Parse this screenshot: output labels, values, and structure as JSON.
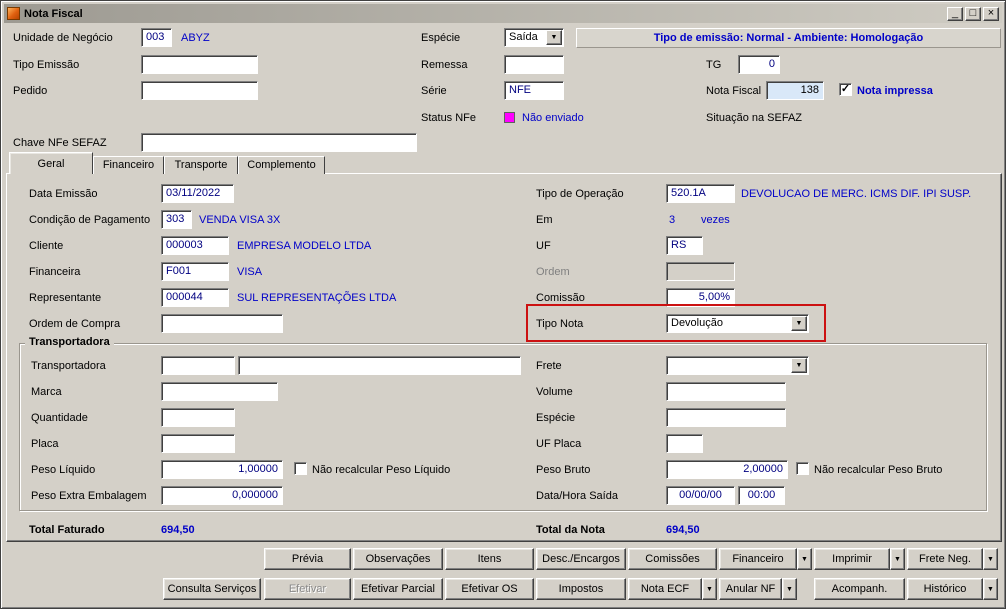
{
  "window": {
    "title": "Nota Fiscal"
  },
  "icons": {
    "dropdown_arrow": "▼",
    "checkmark": "✓",
    "minimize": "_",
    "maximize": "□",
    "close": "×"
  },
  "colors": {
    "window_bg": "#d4d0c8",
    "accent_blue": "#0000C8",
    "field_text_navy": "#000080",
    "status_magenta": "#FF00FF",
    "annotation_red": "#CC1111",
    "nota_fiscal_field_bg": "#d9e8f8"
  },
  "header": {
    "unidade_label": "Unidade de Negócio",
    "unidade_code": "003",
    "unidade_desc": "ABYZ",
    "tipo_emissao_label": "Tipo Emissão",
    "pedido_label": "Pedido",
    "especie_label": "Espécie",
    "especie_value": "Saída",
    "remessa_label": "Remessa",
    "serie_label": "Série",
    "serie_value": "NFE",
    "status_nfe_label": "Status NFe",
    "status_nfe_value": "Não enviado",
    "banner": "Tipo de emissão: Normal - Ambiente: Homologação",
    "tg_label": "TG",
    "tg_value": "0",
    "nota_fiscal_label": "Nota Fiscal",
    "nota_fiscal_value": "138",
    "nota_impressa_label": "Nota impressa",
    "situacao_sefaz_label": "Situação na SEFAZ",
    "chave_label": "Chave NFe SEFAZ"
  },
  "tabs": [
    {
      "label": "Geral"
    },
    {
      "label": "Financeiro"
    },
    {
      "label": "Transporte"
    },
    {
      "label": "Complemento"
    }
  ],
  "geral": {
    "data_emissao_label": "Data Emissão",
    "data_emissao_value": "03/11/2022",
    "cond_pag_label": "Condição de Pagamento",
    "cond_pag_code": "303",
    "cond_pag_desc": "VENDA VISA 3X",
    "cliente_label": "Cliente",
    "cliente_code": "000003",
    "cliente_desc": "EMPRESA MODELO LTDA",
    "financeira_label": "Financeira",
    "financeira_code": "F001",
    "financeira_desc": "VISA",
    "representante_label": "Representante",
    "representante_code": "000044",
    "representante_desc": "SUL REPRESENTAÇÕES LTDA",
    "ordem_compra_label": "Ordem de Compra",
    "tipo_operacao_label": "Tipo de Operação",
    "tipo_operacao_code": "520.1A",
    "tipo_operacao_desc": "DEVOLUCAO DE MERC. ICMS DIF. IPI SUSP.",
    "em_label": "Em",
    "em_value": "3",
    "em_suffix": "vezes",
    "uf_label": "UF",
    "uf_value": "RS",
    "ordem_label": "Ordem",
    "comissao_label": "Comissão",
    "comissao_value": "5,00%",
    "tipo_nota_label": "Tipo Nota",
    "tipo_nota_value": "Devolução"
  },
  "transportadora": {
    "group_label": "Transportadora",
    "transportadora_label": "Transportadora",
    "marca_label": "Marca",
    "quantidade_label": "Quantidade",
    "placa_label": "Placa",
    "peso_liquido_label": "Peso Líquido",
    "peso_liquido_value": "1,00000",
    "nao_recalc_liquido_label": "Não recalcular Peso Líquido",
    "peso_extra_label": "Peso Extra Embalagem",
    "peso_extra_value": "0,000000",
    "frete_label": "Frete",
    "volume_label": "Volume",
    "especie_label": "Espécie",
    "uf_placa_label": "UF Placa",
    "peso_bruto_label": "Peso Bruto",
    "peso_bruto_value": "2,00000",
    "nao_recalc_bruto_label": "Não recalcular Peso Bruto",
    "data_hora_label": "Data/Hora Saída",
    "data_saida_value": "00/00/00",
    "hora_saida_value": "00:00"
  },
  "totals": {
    "faturado_label": "Total Faturado",
    "faturado_value": "694,50",
    "nota_label": "Total da Nota",
    "nota_value": "694,50"
  },
  "buttons_row1": [
    {
      "label": "Prévia"
    },
    {
      "label": "Observações"
    },
    {
      "label": "Itens"
    },
    {
      "label": "Desc./Encargos"
    },
    {
      "label": "Comissões"
    },
    {
      "label": "Financeiro",
      "dropdown": true
    },
    {
      "label": "Imprimir",
      "dropdown": true
    },
    {
      "label": "Frete Neg.",
      "dropdown": true
    }
  ],
  "buttons_row2": [
    {
      "label": "Consulta Serviços"
    },
    {
      "label": "Efetivar",
      "disabled": true
    },
    {
      "label": "Efetivar Parcial"
    },
    {
      "label": "Efetivar OS"
    },
    {
      "label": "Impostos"
    },
    {
      "label": "Nota ECF",
      "dropdown": true
    },
    {
      "label": "Anular NF",
      "dropdown": true
    },
    {
      "label": "Acompanh."
    },
    {
      "label": "Histórico",
      "dropdown": true
    }
  ]
}
